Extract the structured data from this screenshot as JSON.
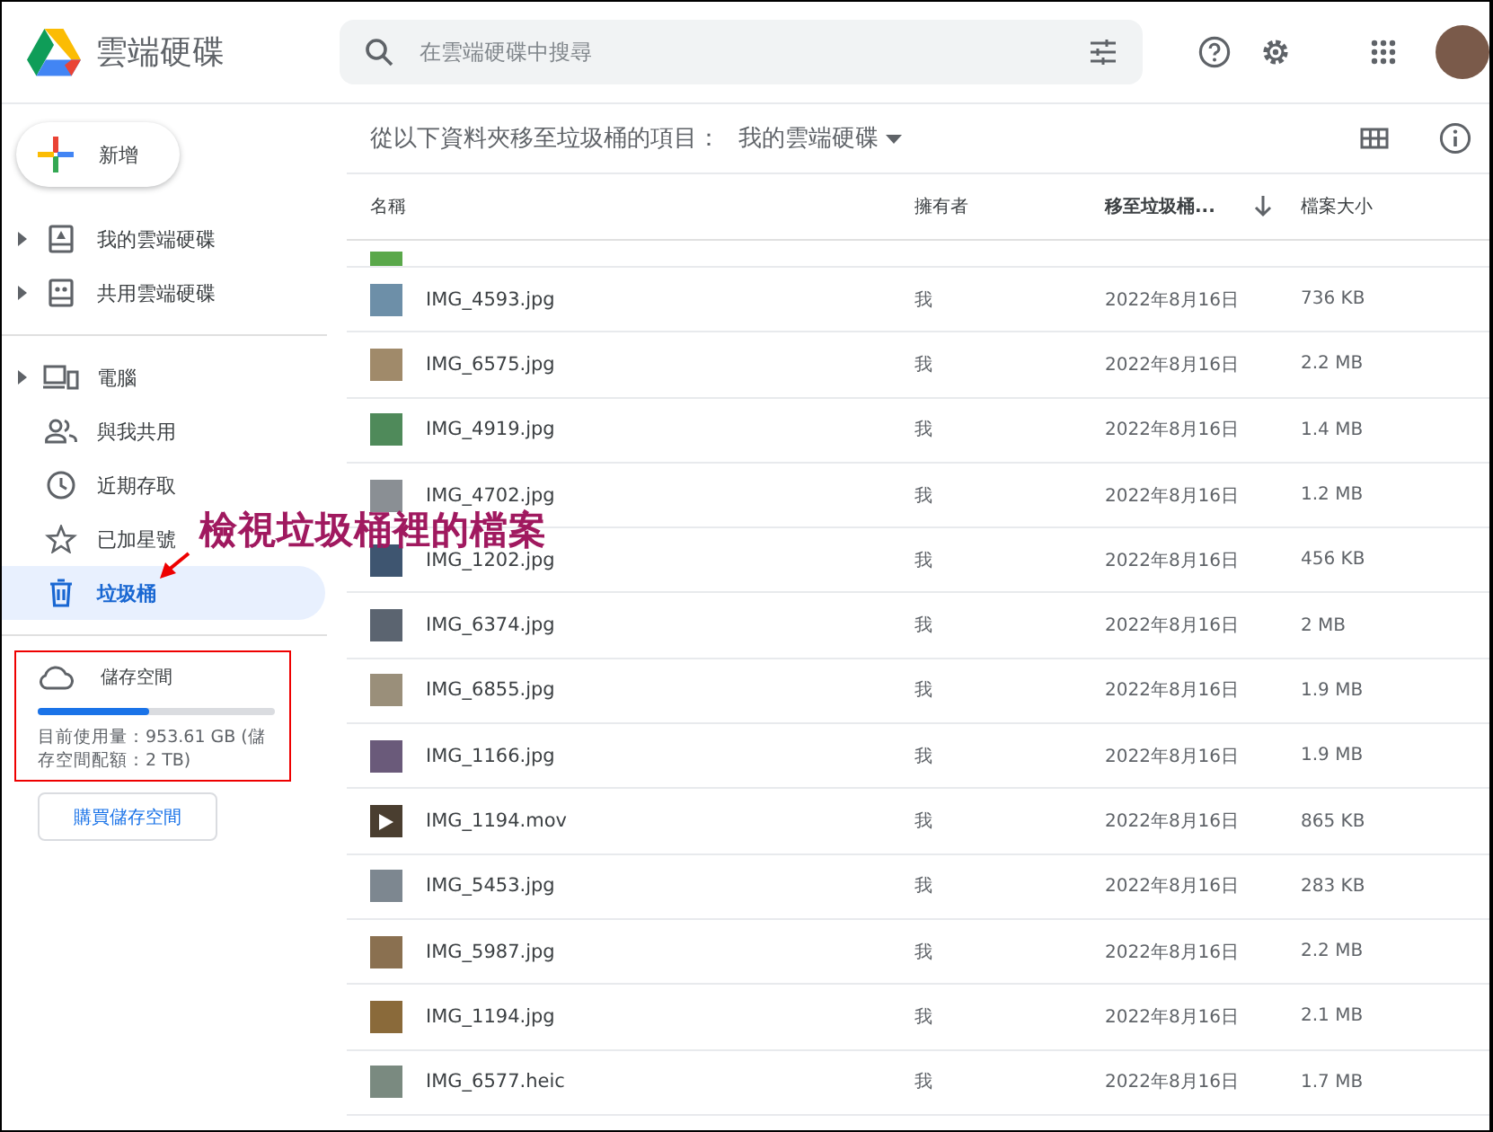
{
  "app": {
    "title": "雲端硬碟"
  },
  "search": {
    "placeholder": "在雲端硬碟中搜尋"
  },
  "new_button": {
    "label": "新增"
  },
  "sidebar": {
    "items": [
      {
        "label": "我的雲端硬碟",
        "expanded": false,
        "selected": false
      },
      {
        "label": "共用雲端硬碟",
        "expanded": false,
        "selected": false
      },
      {
        "label": "電腦",
        "expanded": false,
        "selected": false
      },
      {
        "label": "與我共用",
        "selected": false
      },
      {
        "label": "近期存取",
        "selected": false
      },
      {
        "label": "已加星號",
        "selected": false
      },
      {
        "label": "垃圾桶",
        "selected": true
      }
    ]
  },
  "storage": {
    "label": "儲存空間",
    "level": 0.47,
    "usage": "目前使用量：953.61 GB (儲存空間配額：2 TB)",
    "buy_button": "購買儲存空間"
  },
  "annotation": {
    "text": "檢視垃圾桶裡的檔案"
  },
  "toolbar": {
    "filter_label": "從以下資料夾移至垃圾桶的項目：",
    "folder": "我的雲端硬碟"
  },
  "table": {
    "columns": [
      {
        "label": "名稱",
        "sorted": false
      },
      {
        "label": "擁有者",
        "sorted": false
      },
      {
        "label": "移至垃圾桶...",
        "sorted": true
      },
      {
        "label": "檔案大小",
        "sorted": false
      }
    ],
    "rows": [
      {
        "name": "IMG_4593.jpg",
        "kind": "image",
        "owner": "我",
        "date": "2022年8月16日",
        "size": "736 KB"
      },
      {
        "name": "IMG_6575.jpg",
        "kind": "image",
        "owner": "我",
        "date": "2022年8月16日",
        "size": "2.2 MB"
      },
      {
        "name": "IMG_4919.jpg",
        "kind": "image",
        "owner": "我",
        "date": "2022年8月16日",
        "size": "1.4 MB"
      },
      {
        "name": "IMG_4702.jpg",
        "kind": "image",
        "owner": "我",
        "date": "2022年8月16日",
        "size": "1.2 MB"
      },
      {
        "name": "IMG_1202.jpg",
        "kind": "image",
        "owner": "我",
        "date": "2022年8月16日",
        "size": "456 KB"
      },
      {
        "name": "IMG_6374.jpg",
        "kind": "image",
        "owner": "我",
        "date": "2022年8月16日",
        "size": "2 MB"
      },
      {
        "name": "IMG_6855.jpg",
        "kind": "image",
        "owner": "我",
        "date": "2022年8月16日",
        "size": "1.9 MB"
      },
      {
        "name": "IMG_1166.jpg",
        "kind": "image",
        "owner": "我",
        "date": "2022年8月16日",
        "size": "1.9 MB"
      },
      {
        "name": "IMG_1194.mov",
        "kind": "video",
        "owner": "我",
        "date": "2022年8月16日",
        "size": "865 KB"
      },
      {
        "name": "IMG_5453.jpg",
        "kind": "image",
        "owner": "我",
        "date": "2022年8月16日",
        "size": "283 KB"
      },
      {
        "name": "IMG_5987.jpg",
        "kind": "image",
        "owner": "我",
        "date": "2022年8月16日",
        "size": "2.2 MB"
      },
      {
        "name": "IMG_1194.jpg",
        "kind": "image",
        "owner": "我",
        "date": "2022年8月16日",
        "size": "2.1 MB"
      },
      {
        "name": "IMG_6577.heic",
        "kind": "image",
        "owner": "我",
        "date": "2022年8月16日",
        "size": "1.7 MB"
      }
    ]
  }
}
